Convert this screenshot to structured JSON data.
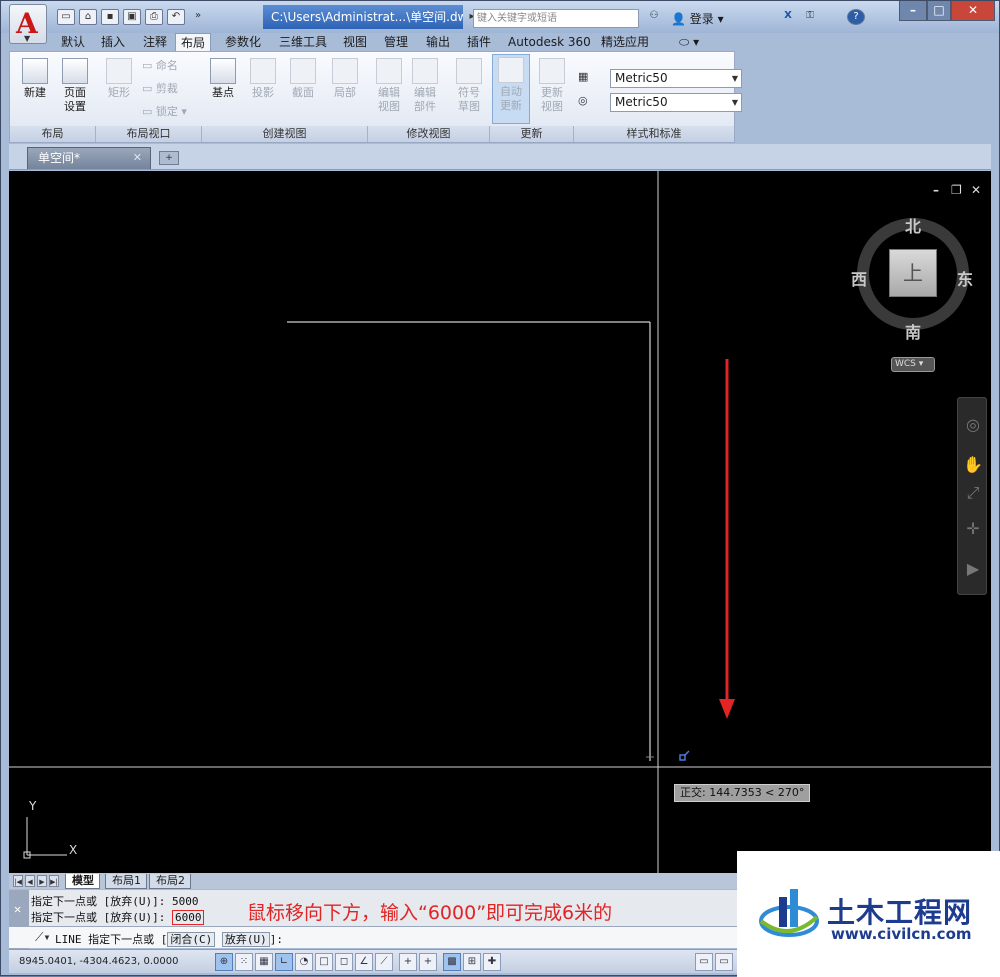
{
  "titlebar": {
    "file_path": "C:\\Users\\Administrat...\\单空间.dwg",
    "search_placeholder": "键入关键字或短语",
    "login_label": "登录"
  },
  "ribbon_tabs": [
    "默认",
    "插入",
    "注释",
    "布局",
    "参数化",
    "三维工具",
    "视图",
    "管理",
    "输出",
    "插件",
    "Autodesk 360",
    "精选应用"
  ],
  "active_tab": "布局",
  "ribbon": {
    "groups": {
      "layout": "布局",
      "layout_viewport": "布局视口",
      "create_view": "创建视图",
      "modify_view": "修改视图",
      "update": "更新",
      "styles": "样式和标准"
    },
    "buttons": {
      "new": "新建",
      "page_setup_1": "页面",
      "page_setup_2": "设置",
      "rectangle": "矩形",
      "rename": "命名",
      "clip": "剪裁",
      "lock": "锁定",
      "base": "基点",
      "projected": "投影",
      "section": "截面",
      "detail": "局部",
      "edit_view_1": "编辑",
      "edit_view_2": "视图",
      "edit_comp_1": "编辑",
      "edit_comp_2": "部件",
      "symbol_1": "符号",
      "symbol_2": "草图",
      "auto_1": "自动",
      "auto_2": "更新",
      "update_1": "更新",
      "update_2": "视图"
    },
    "style_combo_1": "Metric50",
    "style_combo_2": "Metric50"
  },
  "doc_tab": "单空间*",
  "viewcube": {
    "north": "北",
    "south": "南",
    "west": "西",
    "east": "东",
    "face": "上",
    "wcs": "WCS"
  },
  "tooltip": "正交: 144.7353 < 270°",
  "ucs": {
    "x": "X",
    "y": "Y"
  },
  "layout_tabs": [
    "模型",
    "布局1",
    "布局2"
  ],
  "command": {
    "history_1": "指定下一点或 [放弃(U)]: 5000",
    "history_2_prefix": "指定下一点或 [放弃(U)]:",
    "history_2_value": "6000",
    "prompt_cmd": "LINE",
    "prompt_text": "指定下一点或 [",
    "opt_close": "闭合(C)",
    "opt_undo": "放弃(U)",
    "prompt_end": "]:"
  },
  "annotation": "鼠标移向下方，输入“6000”即可完成6米的",
  "status": {
    "coords": "8945.0401, -4304.4623, 0.0000"
  },
  "watermark": {
    "title": "土木工程网",
    "url": "www.civilcn.com"
  },
  "colors": {
    "annotation_red": "#e12424",
    "canvas": "#000000",
    "titlebar_blue": "#2d63b5"
  }
}
